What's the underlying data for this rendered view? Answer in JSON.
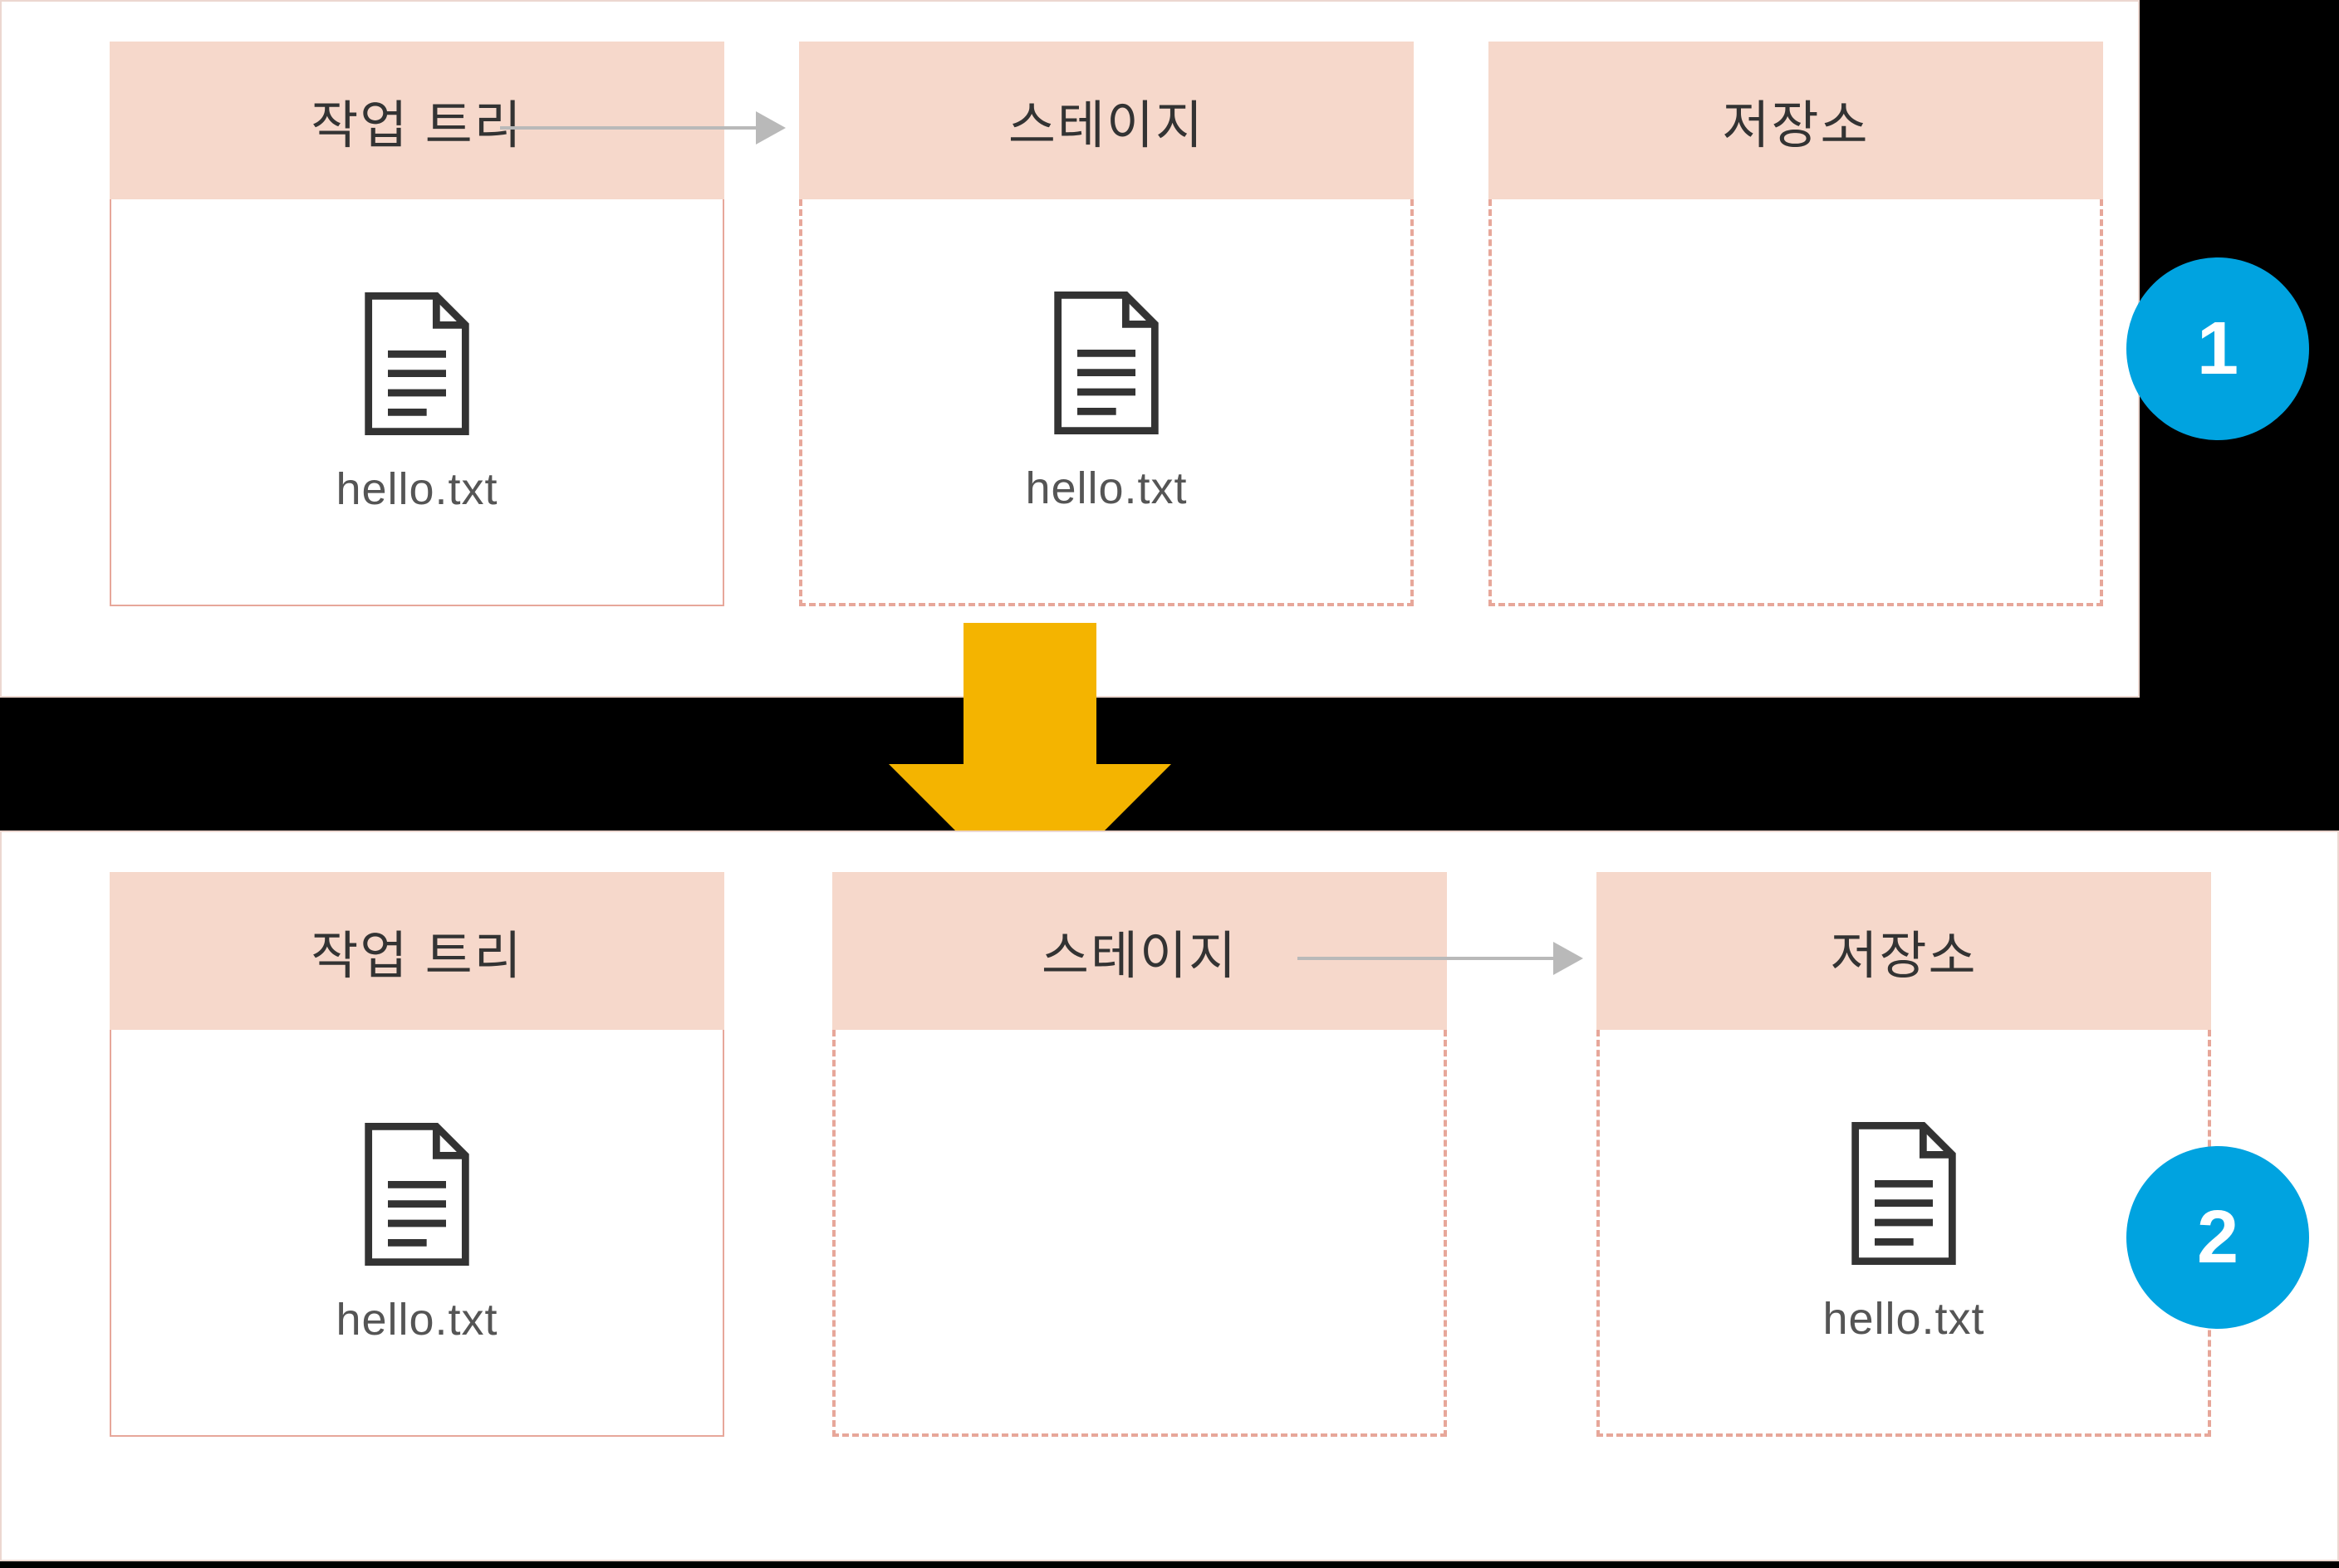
{
  "steps": {
    "step1": {
      "badge": "1"
    },
    "step2": {
      "badge": "2"
    }
  },
  "columns": {
    "workingTree": "작업 트리",
    "stage": "스테이지",
    "repository": "저장소"
  },
  "files": {
    "hello": "hello.txt"
  },
  "colors": {
    "header_bg": "#f6d8cb",
    "badge_bg": "#00a3e0",
    "arrow_down": "#f4b400",
    "arrow_h": "#b9b9b9",
    "border_dashed": "#e7a79a"
  }
}
